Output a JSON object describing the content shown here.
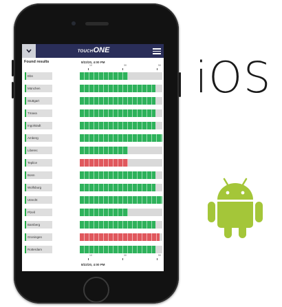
{
  "app": {
    "brand_prefix": "TOUCH",
    "brand_suffix": "ONE",
    "back_icon": "chevron-down-icon",
    "menu_icon": "hamburger-menu-icon"
  },
  "results": {
    "title": "Found results",
    "timestamp_top": "8/22/20, 4:00 PM",
    "timestamp_bottom": "8/22/20, 4:00 PM",
    "axis_ticks": [
      "10",
      "30",
      "50"
    ],
    "rows": [
      {
        "label": "Ebn",
        "fill": 0.58,
        "status": "ok"
      },
      {
        "label": "München",
        "fill": 0.92,
        "status": "ok"
      },
      {
        "label": "Stuttgart",
        "fill": 0.92,
        "status": "ok"
      },
      {
        "label": "Tmava",
        "fill": 0.92,
        "status": "ok"
      },
      {
        "label": "Ingolstadt",
        "fill": 0.92,
        "status": "ok"
      },
      {
        "label": "Amberg",
        "fill": 1.0,
        "status": "ok"
      },
      {
        "label": "Liberec",
        "fill": 0.58,
        "status": "ok"
      },
      {
        "label": "Teplice",
        "fill": 0.58,
        "status": "error"
      },
      {
        "label": "Bonn",
        "fill": 0.92,
        "status": "ok"
      },
      {
        "label": "Wolfsburg",
        "fill": 0.92,
        "status": "ok"
      },
      {
        "label": "Utrecht",
        "fill": 1.0,
        "status": "ok"
      },
      {
        "label": "Plzeň",
        "fill": 0.58,
        "status": "ok"
      },
      {
        "label": "Bamberg",
        "fill": 0.92,
        "status": "ok"
      },
      {
        "label": "Groningen",
        "fill": 0.97,
        "status": "error"
      },
      {
        "label": "Rotterdam",
        "fill": 0.92,
        "status": "ok"
      }
    ]
  },
  "platforms": {
    "ios_text": "iOS",
    "android_icon": "android-robot-icon"
  },
  "colors": {
    "navbar": "#2a2e59",
    "ok": "#2eb25b",
    "error": "#e0585d",
    "track": "#d9d9d9",
    "android": "#a4c639"
  }
}
